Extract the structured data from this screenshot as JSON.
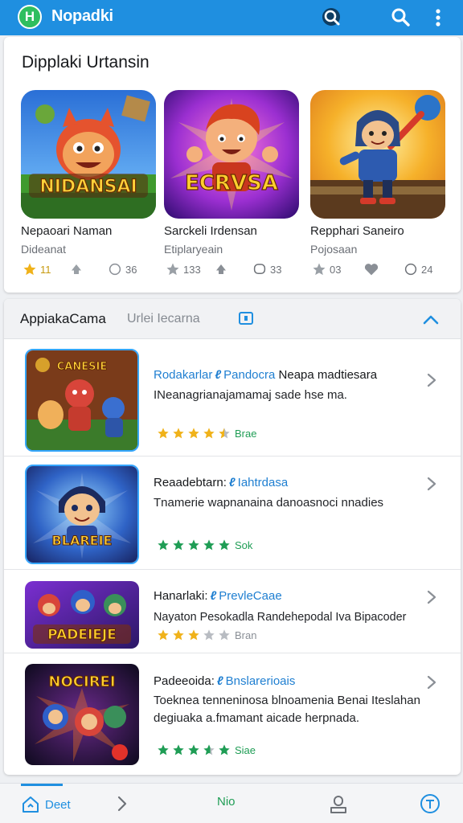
{
  "app": {
    "logo_letter": "H",
    "title": "Nopadki"
  },
  "topbar_icons": [
    "search-icon",
    "search-icon",
    "more-vertical-icon"
  ],
  "featured": {
    "title": "Dipplaki Urtansin",
    "items": [
      {
        "name": "Nepaoari Naman",
        "developer": "Dideanat",
        "thumb_text": "NIDANSAI",
        "rating": "11",
        "stat2": "",
        "stat3": "36"
      },
      {
        "name": "Sarckeli Irdensan",
        "developer": "Etiplaryeain",
        "thumb_text": "ECRVSA",
        "rating": "133",
        "stat2": "",
        "stat3": "33"
      },
      {
        "name": "Repphari Saneiro",
        "developer": "Pojosaan",
        "thumb_text": "",
        "rating": "03",
        "stat2": "",
        "stat3": "24"
      }
    ]
  },
  "list": {
    "title": "AppiakaCama",
    "subtitle": "Urlei Iecarna",
    "items": [
      {
        "title_main": "Rodakarlar",
        "title_tag": "Pandocra",
        "title_rest": "Neapa madtiesara",
        "description": "INeanagrianajamamaj sade hse ma.",
        "thumb_text": "CANESIE",
        "stars": [
          1,
          1,
          1,
          1,
          0.5
        ],
        "rating": "Brae",
        "star_color": "#f0b21a",
        "rating_color": "#1f9d55"
      },
      {
        "title_main": "Reaadebtarn:",
        "title_tag": "Iahtrdasa",
        "title_rest": "",
        "description": "Tnamerie wapnanaina danoasnoci nnadies",
        "thumb_text": "BLAREIE",
        "stars": [
          1,
          1,
          1,
          1,
          1
        ],
        "rating": "Sok",
        "star_color": "#1f9d55",
        "rating_color": "#1f9d55"
      },
      {
        "title_main": "Hanarlaki:",
        "title_tag": "PrevleCaae",
        "title_rest": "",
        "description": "Nayaton Pesokadla Randehepodal Iva Bipacoder",
        "thumb_text": "PADEIEJE",
        "stars": [
          1,
          1,
          1,
          0,
          0
        ],
        "rating": "Bran",
        "star_color": "#f0b21a",
        "rating_color": "#8a8f96"
      },
      {
        "title_main": "Padeeoida:",
        "title_tag": "Bnslarerioais",
        "title_rest": "",
        "description": "Toeknea tenneninosa blnoamenia Benai Iteslahan degiuaka a.fmamant aicade herpnada.",
        "thumb_text": "NOCIREI",
        "stars": [
          1,
          1,
          1,
          0.6,
          1
        ],
        "rating": "Siae",
        "star_color": "#1f9d55",
        "rating_color": "#1f9d55"
      }
    ]
  },
  "bottom_nav": {
    "home_label": "Deet",
    "center_label": "Nio",
    "colors": {
      "accent": "#1f8fe0",
      "center": "#1f9d55"
    }
  },
  "colors": {
    "primary": "#1f8fe0",
    "logo_green": "#2fbe5f",
    "star_gold": "#f0b21a",
    "star_green": "#1f9d55"
  }
}
